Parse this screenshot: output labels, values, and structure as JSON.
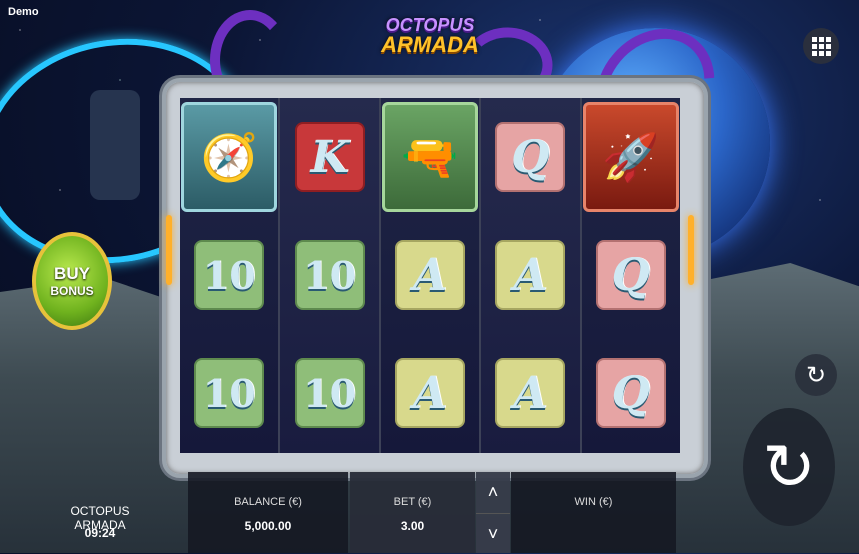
{
  "top_label": "Demo",
  "logo": {
    "line1": "OCTOPUS",
    "line2": "ARMADA"
  },
  "buy_bonus": {
    "line1": "BUY",
    "line2": "BONUS"
  },
  "reels": [
    {
      "symbols": [
        {
          "type": "big",
          "style": "teal",
          "glyph": "🧭",
          "icon": "compass-icon"
        },
        {
          "type": "num",
          "style": "green",
          "glyph": "10"
        },
        {
          "type": "num",
          "style": "green",
          "glyph": "10"
        }
      ]
    },
    {
      "symbols": [
        {
          "type": "letter",
          "style": "red",
          "glyph": "K"
        },
        {
          "type": "num",
          "style": "green",
          "glyph": "10"
        },
        {
          "type": "num",
          "style": "green",
          "glyph": "10"
        }
      ]
    },
    {
      "symbols": [
        {
          "type": "big",
          "style": "green",
          "glyph": "🔫",
          "icon": "ray-gun-icon"
        },
        {
          "type": "letter",
          "style": "yellow",
          "glyph": "A"
        },
        {
          "type": "letter",
          "style": "yellow",
          "glyph": "A"
        }
      ]
    },
    {
      "symbols": [
        {
          "type": "letter",
          "style": "pink",
          "glyph": "Q"
        },
        {
          "type": "letter",
          "style": "yellow",
          "glyph": "A"
        },
        {
          "type": "letter",
          "style": "yellow",
          "glyph": "A"
        }
      ]
    },
    {
      "symbols": [
        {
          "type": "big",
          "style": "red",
          "glyph": "🚀",
          "icon": "rocket-icon"
        },
        {
          "type": "letter",
          "style": "pink",
          "glyph": "Q"
        },
        {
          "type": "letter",
          "style": "pink",
          "glyph": "Q"
        }
      ]
    }
  ],
  "footer": {
    "game_name": "OCTOPUS ARMADA",
    "time": "09:24",
    "balance_label": "BALANCE (€)",
    "balance_value": "5,000.00",
    "bet_label": "BET (€)",
    "bet_value": "3.00",
    "win_label": "WIN (€)",
    "win_value": ""
  },
  "icons": {
    "menu": "grid-menu-icon",
    "autoplay": "autoplay-icon",
    "spin": "spin-icon",
    "bet_up": "chevron-up-icon",
    "bet_down": "chevron-down-icon"
  },
  "colors": {
    "accent": "#ffb02a",
    "tentacle": "#6d2fc0",
    "buy_bonus": "#6fb21e"
  }
}
